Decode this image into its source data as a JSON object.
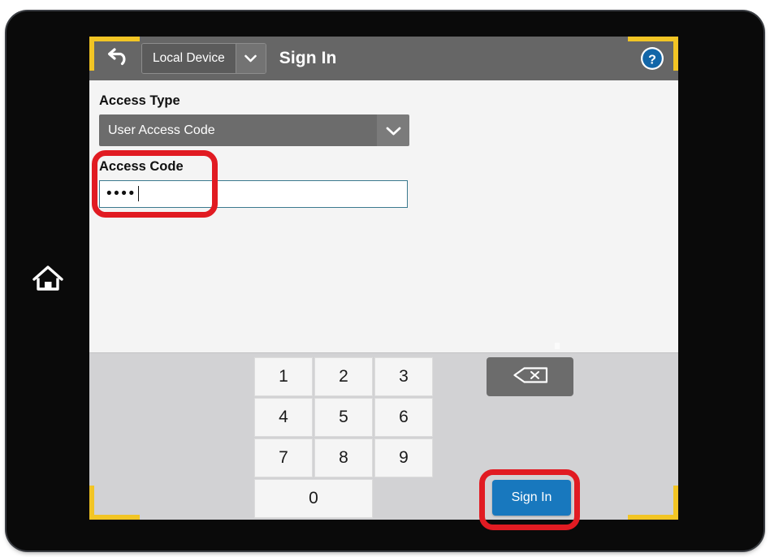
{
  "device": {
    "home_icon": "home-icon"
  },
  "topbar": {
    "back_icon": "undo-arrow-icon",
    "device_selector": {
      "value": "Local Device",
      "chevron_icon": "chevron-down-icon"
    },
    "title": "Sign In",
    "help_icon": "help-circle-icon"
  },
  "form": {
    "access_type": {
      "label": "Access Type",
      "value": "User Access Code",
      "chevron_icon": "chevron-down-icon"
    },
    "access_code": {
      "label": "Access Code",
      "masked_value": "••••",
      "character_count": 4
    }
  },
  "keypad": {
    "keys": [
      "1",
      "2",
      "3",
      "4",
      "5",
      "6",
      "7",
      "8",
      "9",
      "0"
    ],
    "backspace_icon": "backspace-delete-icon",
    "submit_label": "Sign In"
  },
  "colors": {
    "accent_blue": "#1878be",
    "topbar_gray": "#666666",
    "field_border_teal": "#3b7a8e",
    "highlight_red": "#e11b22",
    "focus_yellow": "#f2c524"
  }
}
